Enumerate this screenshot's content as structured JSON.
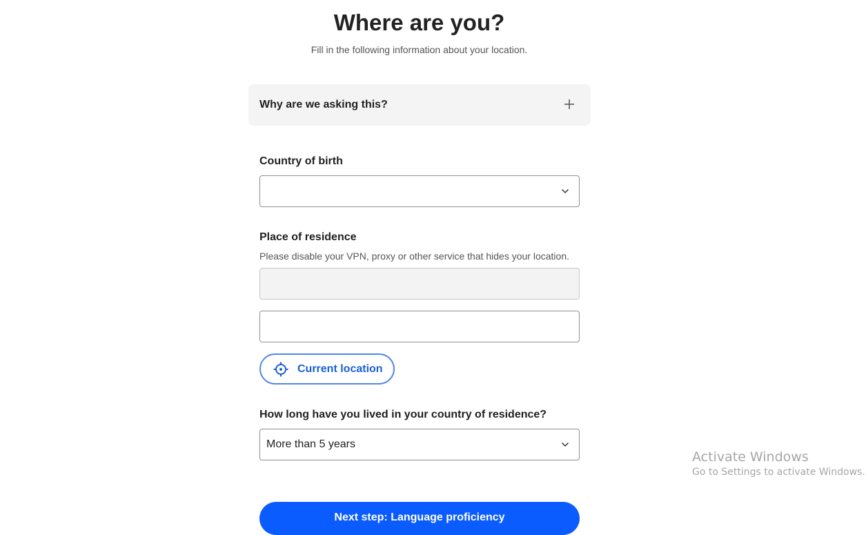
{
  "header": {
    "title": "Where are you?",
    "subtitle": "Fill in the following information about your location."
  },
  "faq": {
    "title": "Why are we asking this?",
    "icon": "plus-icon"
  },
  "country_of_birth": {
    "label": "Country of birth",
    "value": "",
    "icon": "chevron-down-icon"
  },
  "place_of_residence": {
    "label": "Place of residence",
    "hint": "Please disable your VPN, proxy or other service that hides your location.",
    "country_value": "",
    "address_value": "",
    "current_location_label": "Current location",
    "current_location_icon": "crosshair-icon"
  },
  "duration": {
    "label": "How long have you lived in your country of residence?",
    "value": "More than 5 years",
    "icon": "chevron-down-icon"
  },
  "next_button": {
    "label": "Next step: Language proficiency"
  },
  "watermark": {
    "title": "Activate Windows",
    "subtitle": "Go to Settings to activate Windows."
  },
  "colors": {
    "primary": "#0b5cff",
    "outline_button_border": "#4f86ee",
    "outline_button_text": "#1a5fd6",
    "faq_background": "#f4f4f4",
    "disabled_field": "#f3f3f3"
  }
}
